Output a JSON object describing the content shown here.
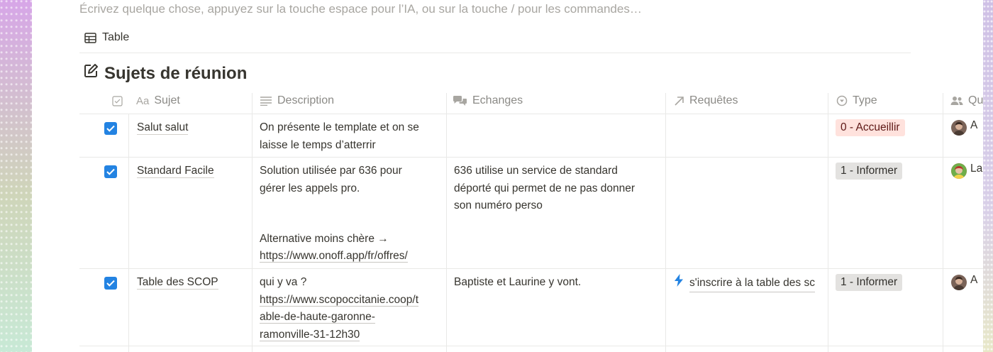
{
  "placeholder": "Écrivez quelque chose, appuyez sur la touche espace pour l’IA, ou sur la touche / pour les commandes…",
  "view_tab": {
    "icon": "table-icon",
    "label": "Table"
  },
  "database": {
    "icon": "edit-icon",
    "title": "Sujets de réunion"
  },
  "columns": [
    {
      "icon": "checkbox-icon",
      "label": ""
    },
    {
      "icon": "title-icon",
      "icon_text": "Aa",
      "label": "Sujet"
    },
    {
      "icon": "text-lines-icon",
      "label": "Description"
    },
    {
      "icon": "chat-icon",
      "label": "Echanges"
    },
    {
      "icon": "arrow-up-right-icon",
      "label": "Requêtes"
    },
    {
      "icon": "select-icon",
      "label": "Type"
    },
    {
      "icon": "people-icon",
      "label": "Qu"
    }
  ],
  "rows": [
    {
      "checked": true,
      "sujet": "Salut salut",
      "description": [
        "On présente le template et on se",
        "laisse le temps d’atterrir"
      ],
      "echanges": [],
      "requetes": "",
      "type": {
        "label": "0 - Accueillir",
        "bg": "#ffe2dd",
        "color": "#5d1715"
      },
      "person": {
        "initial": "A"
      }
    },
    {
      "checked": true,
      "sujet": "Standard Facile",
      "description": [
        "Solution utilisée par 636 pour",
        "gérer les appels pro.",
        "",
        "",
        "Alternative moins chère →"
      ],
      "description_link": "https://www.onoff.app/fr/offres/",
      "echanges": [
        "636 utilise un service de standard",
        "déporté qui permet de ne pas donner",
        "son numéro perso"
      ],
      "requetes": "",
      "type": {
        "label": "1 - Informer",
        "bg": "#e3e2e0",
        "color": "#32302c"
      },
      "person": {
        "initial": "La"
      }
    },
    {
      "checked": true,
      "sujet": "Table des SCOP",
      "description": [
        "qui y va ?"
      ],
      "description_link_lines": [
        "https://www.scopoccitanie.coop/t",
        "able-de-haute-garonne-",
        "ramonville-31-12h30"
      ],
      "echanges": [
        "Baptiste et Laurine y vont."
      ],
      "requetes": "s'inscrire à la table des sc",
      "requetes_icon": "lightning-icon",
      "type": {
        "label": "1 - Informer",
        "bg": "#e3e2e0",
        "color": "#32302c"
      },
      "person": {
        "initial": "A"
      }
    }
  ],
  "colors": {
    "accent": "#2383e2",
    "text": "#37352f",
    "muted": "#8b8a86",
    "border": "#e9e9e7"
  }
}
